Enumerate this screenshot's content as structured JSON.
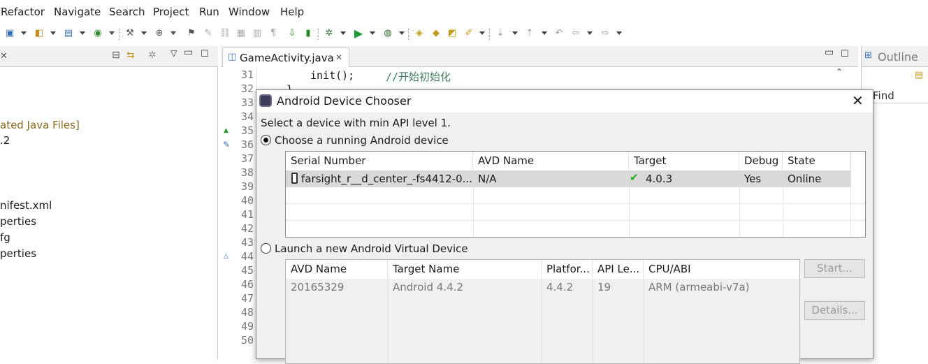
{
  "menubar": [
    "Refactor",
    "Navigate",
    "Search",
    "Project",
    "Run",
    "Window",
    "Help"
  ],
  "left_panel": {
    "tree": [
      "ated Java Files]",
      ".2",
      "nifest.xml",
      "perties",
      "fg",
      "perties"
    ]
  },
  "editor": {
    "tab_label": "GameActivity.java",
    "line_numbers": [
      "31",
      "32",
      "33",
      "34",
      "35",
      "36",
      "37",
      "38",
      "39",
      "40",
      "41",
      "42",
      "43",
      "44",
      "45",
      "46",
      "47",
      "48",
      "49",
      "50"
    ],
    "code": {
      "init_call": "init();",
      "comment": "//开始初始化",
      "brace": "}"
    }
  },
  "outline": {
    "title": "Outline",
    "find_placeholder": "Find"
  },
  "dialog": {
    "title": "Android Device Chooser",
    "subtitle": "Select a device with min API level 1.",
    "running_label": "Choose a running Android device",
    "launch_label": "Launch a new Android Virtual Device",
    "devices": {
      "headers": [
        "Serial Number",
        "AVD Name",
        "Target",
        "Debug",
        "State"
      ],
      "rows": [
        {
          "serial": "farsight_r__d_center_-fs4412-0...",
          "avd": "N/A",
          "target": "4.0.3",
          "debug": "Yes",
          "state": "Online"
        }
      ]
    },
    "avds": {
      "headers": [
        "AVD Name",
        "Target Name",
        "Platfor...",
        "API Le...",
        "CPU/ABI"
      ],
      "rows": [
        {
          "name": "20165329",
          "target": "Android 4.4.2",
          "platform": "4.4.2",
          "api": "19",
          "cpu": "ARM (armeabi-v7a)"
        }
      ]
    },
    "buttons": {
      "start": "Start...",
      "details": "Details..."
    }
  },
  "colors": {
    "tree_text_brown": "#8b6a1f",
    "comment_green": "#3f7f5f",
    "selected_row": "#d9d9d9",
    "check_green": "#22aa22"
  }
}
